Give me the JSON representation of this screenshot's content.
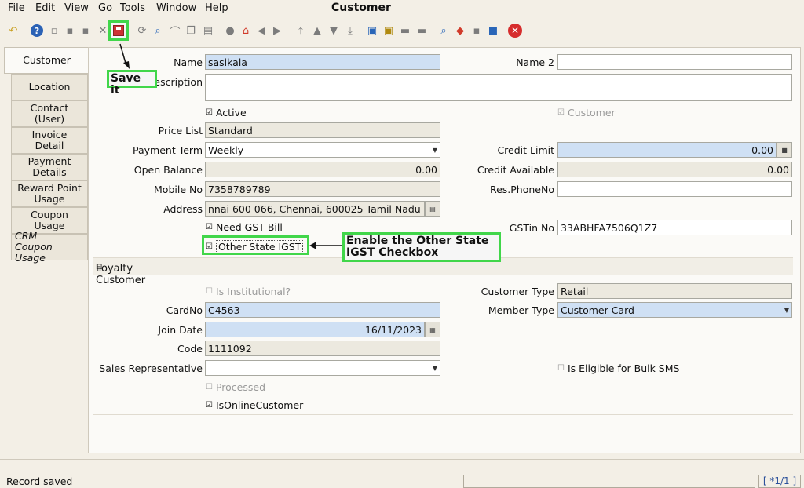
{
  "menu": [
    "File",
    "Edit",
    "View",
    "Go",
    "Tools",
    "Window",
    "Help"
  ],
  "window_title": "Customer",
  "tabs": [
    "Customer",
    "Location",
    "Contact (User)",
    "Invoice Detail",
    "Payment Details",
    "Reward Point Usage",
    "Coupon Usage",
    "CRM Coupon Usage"
  ],
  "form": {
    "name_label": "Name",
    "name_value": "sasikala",
    "name2_label": "Name 2",
    "name2_value": "",
    "description_label": "Description",
    "description_value": "",
    "active_label": "Active",
    "customer_label": "Customer",
    "price_list_label": "Price List",
    "price_list_value": "Standard",
    "payment_term_label": "Payment Term",
    "payment_term_value": "Weekly",
    "credit_limit_label": "Credit Limit",
    "credit_limit_value": "0.00",
    "open_balance_label": "Open Balance",
    "open_balance_value": "0.00",
    "credit_available_label": "Credit Available",
    "credit_available_value": "0.00",
    "mobile_label": "Mobile No",
    "mobile_value": "7358789789",
    "res_phone_label": "Res.PhoneNo",
    "res_phone_value": "",
    "address_label": "Address",
    "address_value": "nnai 600 066, Chennai,  600025 Tamil Nadu",
    "need_gst_label": "Need GST Bill",
    "gstin_label": "GSTin No",
    "gstin_value": "33ABHFA7506Q1Z7",
    "other_state_label": "Other State IGST",
    "loyalty_section": "Loyalty Customer",
    "is_institutional_label": "Is Institutional?",
    "customer_type_label": "Customer Type",
    "customer_type_value": "Retail",
    "cardno_label": "CardNo",
    "cardno_value": "C4563",
    "member_type_label": "Member Type",
    "member_type_value": "Customer Card",
    "join_date_label": "Join Date",
    "join_date_value": "16/11/2023",
    "code_label": "Code",
    "code_value": "1111092",
    "sales_rep_label": "Sales Representative",
    "sales_rep_value": "",
    "bulk_sms_label": "Is Eligible for Bulk SMS",
    "processed_label": "Processed",
    "online_customer_label": "IsOnlineCustomer"
  },
  "annotations": {
    "save": "Save it",
    "igst": "Enable the Other State IGST Checkbox"
  },
  "status": {
    "message": "Record saved",
    "record_count": "[ *1/1 ]"
  },
  "colors": {
    "highlight": "#41d64a",
    "mandatory": "#cfe0f4"
  }
}
